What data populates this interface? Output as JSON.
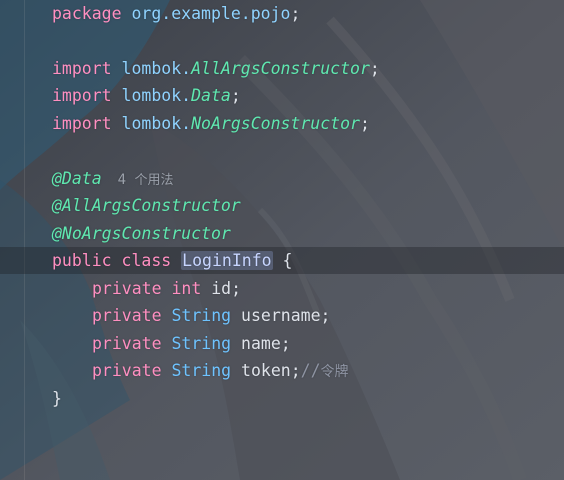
{
  "code": {
    "package_kw": "package",
    "package_name": "org.example.pojo",
    "semicolon": ";",
    "import_kw": "import",
    "lombok_prefix": "lombok.",
    "imports": [
      "AllArgsConstructor",
      "Data",
      "NoArgsConstructor"
    ],
    "annotations": [
      "@Data",
      "@AllArgsConstructor",
      "@NoArgsConstructor"
    ],
    "usage_count": "4",
    "usage_label": "个用法",
    "public_kw": "public",
    "class_kw": "class",
    "class_name": "LoginInfo",
    "open_brace": "{",
    "close_brace": "}",
    "private_kw": "private",
    "fields": [
      {
        "type": "int",
        "name": "id"
      },
      {
        "type": "String",
        "name": "username"
      },
      {
        "type": "String",
        "name": "name"
      },
      {
        "type": "String",
        "name": "token"
      }
    ],
    "token_comment_prefix": "//",
    "token_comment_text": "令牌"
  },
  "colors": {
    "keyword": "#ff8fc1",
    "type": "#6ec3ff",
    "annotation": "#5fe8b0",
    "comment": "#8e94a3"
  }
}
